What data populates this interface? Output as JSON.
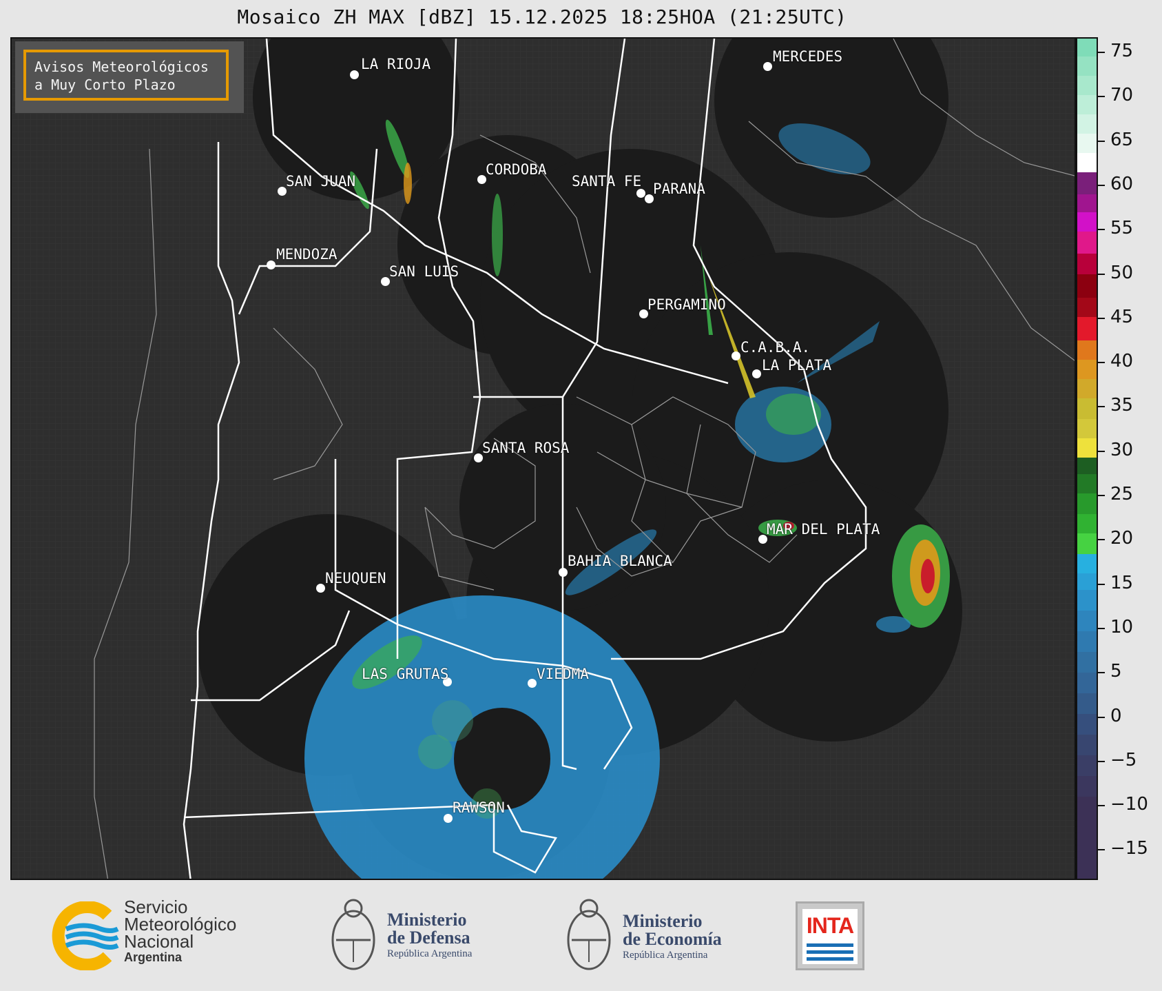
{
  "title": "Mosaico ZH MAX [dBZ] 15.12.2025 18:25HOA (21:25UTC)",
  "notice": {
    "line1": "Avisos Meteorológicos",
    "line2": "a Muy Corto Plazo"
  },
  "cities": [
    {
      "id": "la-rioja",
      "label": "LA RIOJA"
    },
    {
      "id": "mercedes",
      "label": "MERCEDES"
    },
    {
      "id": "san-juan",
      "label": "SAN JUAN"
    },
    {
      "id": "cordoba",
      "label": "CORDOBA"
    },
    {
      "id": "santa-fe",
      "label": "SANTA FE"
    },
    {
      "id": "parana",
      "label": "PARANA"
    },
    {
      "id": "mendoza",
      "label": "MENDOZA"
    },
    {
      "id": "san-luis",
      "label": "SAN LUIS"
    },
    {
      "id": "pergamino",
      "label": "PERGAMINO"
    },
    {
      "id": "caba",
      "label": "C.A.B.A."
    },
    {
      "id": "la-plata",
      "label": "LA PLATA"
    },
    {
      "id": "santa-rosa",
      "label": "SANTA ROSA"
    },
    {
      "id": "mar-del-plata",
      "label": "MAR DEL PLATA"
    },
    {
      "id": "bahia-blanca",
      "label": "BAHIA BLANCA"
    },
    {
      "id": "neuquen",
      "label": "NEUQUEN"
    },
    {
      "id": "las-grutas",
      "label": "LAS GRUTAS"
    },
    {
      "id": "viedma",
      "label": "VIEDMA"
    },
    {
      "id": "rawson",
      "label": "RAWSON"
    }
  ],
  "colorbar": {
    "unit": "dBZ",
    "ticks": [
      "75",
      "70",
      "65",
      "60",
      "55",
      "50",
      "45",
      "40",
      "35",
      "30",
      "25",
      "20",
      "15",
      "10",
      "5",
      "0",
      "−5",
      "−10",
      "−15"
    ]
  },
  "footer": {
    "smn": {
      "line1": "Servicio",
      "line2": "Meteorológico",
      "line3": "Nacional",
      "line4": "Argentina"
    },
    "defensa": {
      "line1": "Ministerio",
      "line2": "de Defensa",
      "line3": "República Argentina"
    },
    "economia": {
      "line1": "Ministerio",
      "line2": "de Economía",
      "line3": "República Argentina"
    },
    "inta": {
      "label": "INTA"
    }
  },
  "colors": {
    "map_bg": "#2e2e2e",
    "radar_coverage": "#1b1b1b",
    "notice_border": "#f0a000",
    "smn_blue": "#1a9ad6",
    "smn_yellow": "#f6b400",
    "inta_red": "#e4261c"
  }
}
